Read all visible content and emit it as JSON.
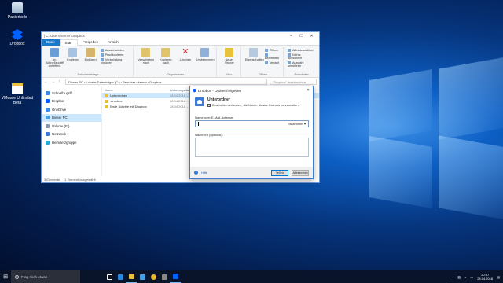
{
  "desktop": {
    "icons": [
      {
        "label": "Papierkorb",
        "icon": "recycle-bin-icon"
      },
      {
        "label": "Dropbox",
        "icon": "dropbox-icon"
      },
      {
        "label": "VMware Unlimited Beta",
        "icon": "file-icon"
      }
    ]
  },
  "explorer": {
    "title": "| C:\\Users\\kemer\\Dropbox",
    "ribbon_tabs": [
      "Datei",
      "Start",
      "Freigeben",
      "Ansicht"
    ],
    "ribbon": {
      "clipboard": {
        "pin": "An Schnellzugriff anheften",
        "copy": "Kopieren",
        "paste": "Einfügen",
        "cut": "Ausschneiden",
        "copy_path": "Pfad kopieren",
        "paste_link": "Verknüpfung einfügen",
        "group": "Zwischenablage"
      },
      "organize": {
        "move": "Verschieben nach",
        "copyto": "Kopieren nach",
        "delete": "Löschen",
        "rename": "Umbenennen",
        "group": "Organisieren"
      },
      "new": {
        "new_folder": "Neuer Ordner",
        "group": "Neu"
      },
      "open": {
        "properties": "Eigenschaften",
        "open": "Öffnen",
        "edit": "Bearbeiten",
        "history": "Verlauf",
        "group": "Öffnen"
      },
      "select": {
        "all": "Alles auswählen",
        "none": "Nichts auswählen",
        "invert": "Auswahl umkehren",
        "group": "Auswählen"
      }
    },
    "address": "Dieses PC › Lokaler Datenträger (C:) › Benutzer › kemer › Dropbox",
    "search_placeholder": "\"Dropbox\" durchsuchen",
    "nav": [
      "Schnellzugriff",
      "Dropbox",
      "OneDrive",
      "Dieser PC",
      "Volume (E:)",
      "Netzwerk",
      "Heimnetzgruppe"
    ],
    "columns": {
      "name": "Name",
      "date": "Änderungsdatum",
      "type": "Typ",
      "size": "Größe"
    },
    "files": [
      {
        "name": "Unterordner",
        "date": "28.04.2016 ..."
      },
      {
        "name": ".dropbox",
        "date": "28.04.2016 ..."
      },
      {
        "name": "Erste Schritte mit Dropbox",
        "date": "28.04.2016 ..."
      }
    ],
    "status": {
      "count": "3 Elemente",
      "selected": "1 Element ausgewählt"
    }
  },
  "dialog": {
    "title": "Dropbox - Ordner freigeben",
    "folder_name": "Unterordner",
    "permission_text": "Bearbeitern erlauben, die Nutzer dieses Ordners zu verwalten",
    "email_label": "Name oder E-Mail-Adresse:",
    "email_value": "",
    "permission_select": "Bearbeiter",
    "message_label": "Nachricht (optional):",
    "help": "Hilfe",
    "share_button": "Teilen",
    "cancel_button": "Abbrechen"
  },
  "taskbar": {
    "search_placeholder": "Frag mich etwas",
    "time": "20:37",
    "date": "28.04.2016"
  }
}
